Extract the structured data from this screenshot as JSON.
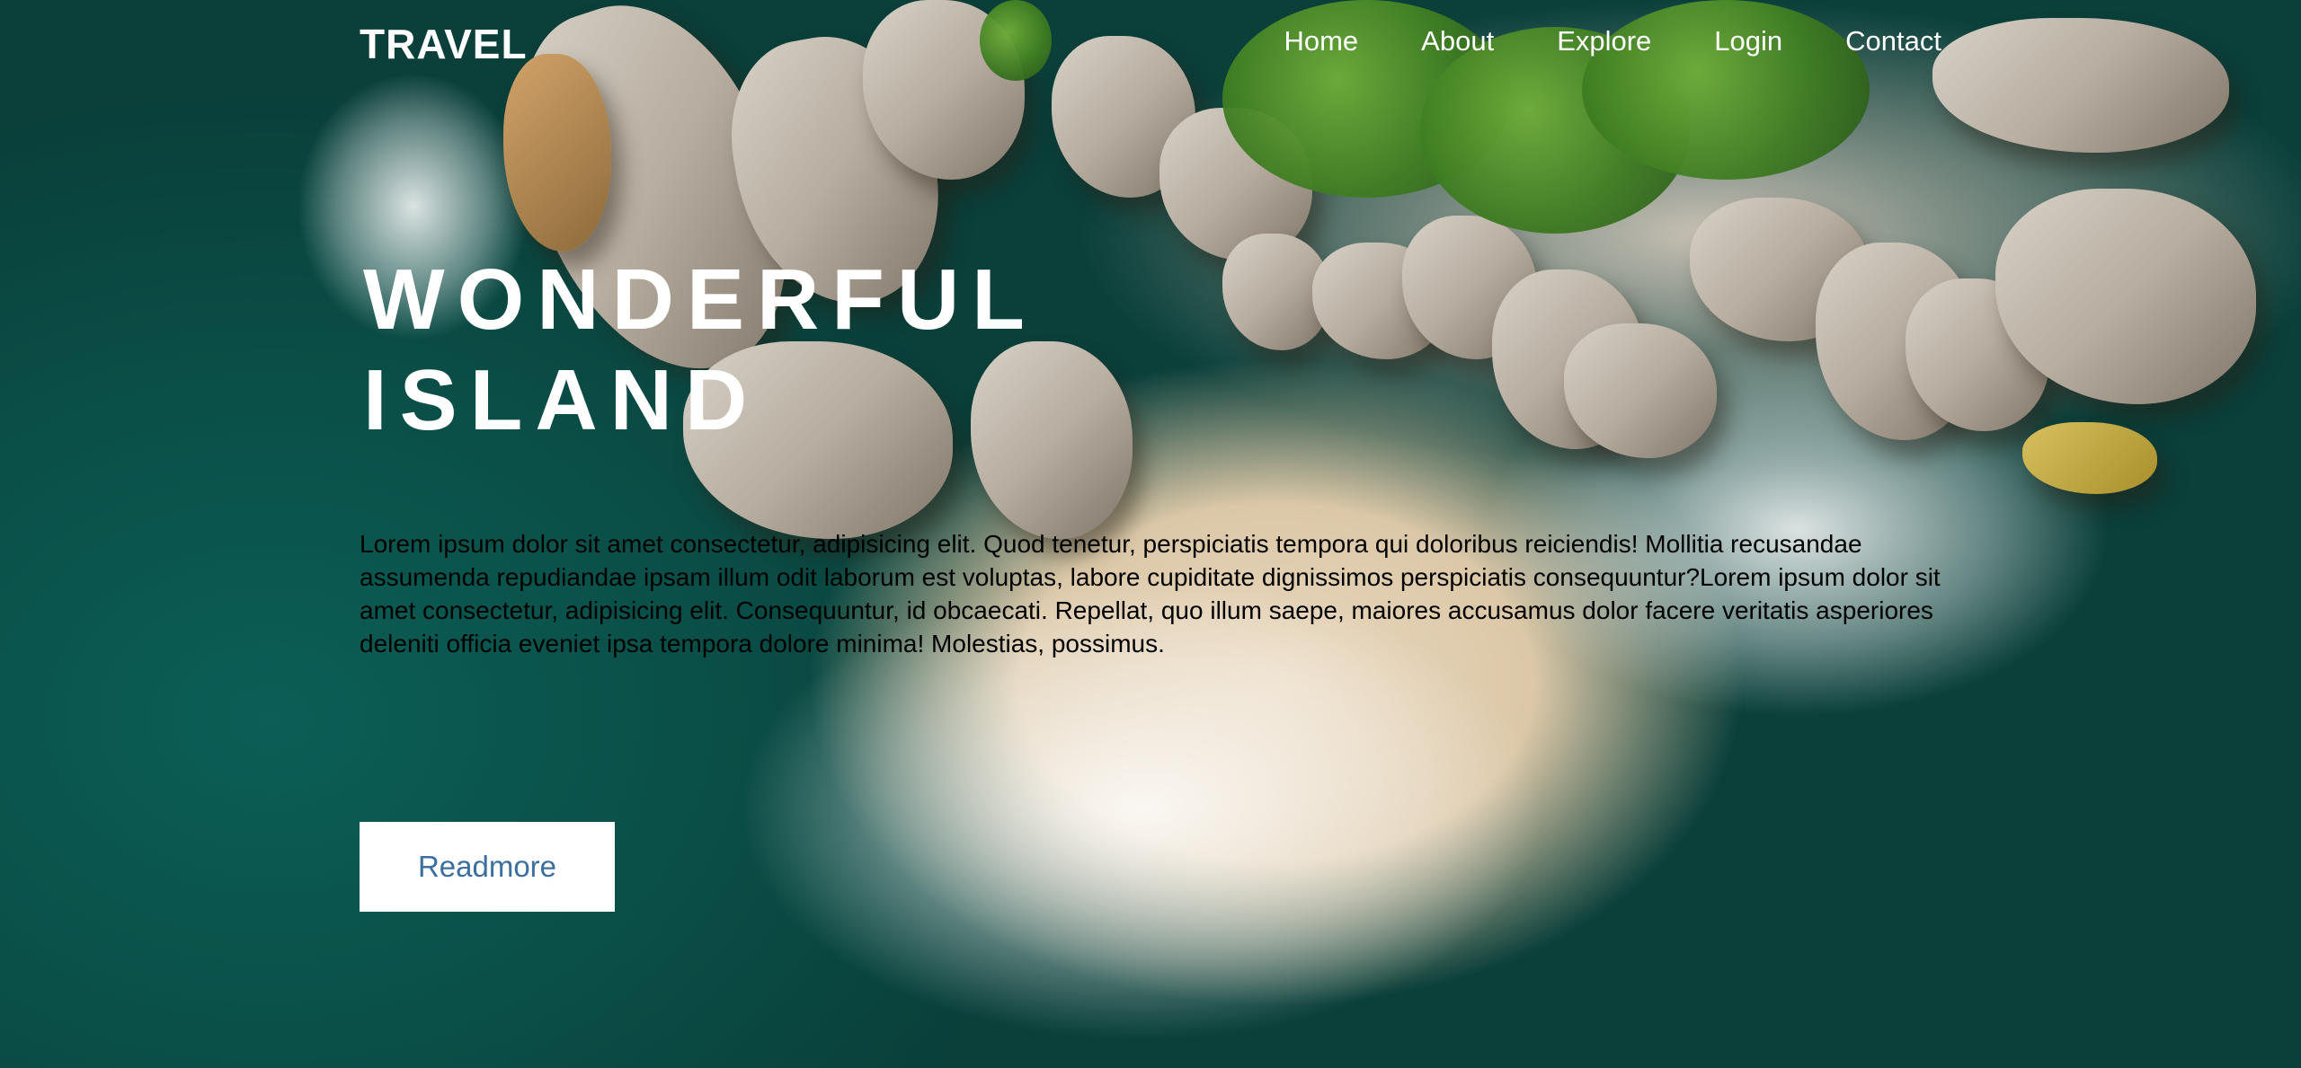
{
  "header": {
    "logo": "TRAVEL",
    "nav": [
      "Home",
      "About",
      "Explore",
      "Login",
      "Contact"
    ]
  },
  "hero": {
    "title_line1": "WONDERFUL",
    "title_line2": "ISLAND",
    "description": "Lorem ipsum dolor sit amet consectetur, adipisicing elit. Quod tenetur, perspiciatis tempora qui doloribus reiciendis! Mollitia recusandae assumenda repudiandae ipsam illum odit laborum est voluptas, labore cupiditate dignissimos perspiciatis consequuntur?Lorem ipsum dolor sit amet consectetur, adipisicing elit. Consequuntur, id obcaecati. Repellat, quo illum saepe, maiores accusamus dolor facere veritatis asperiores deleniti officia eveniet ipsa tempora dolore minima! Molestias, possimus.",
    "button_label": "Readmore"
  },
  "colors": {
    "text_on_image": "#ffffff",
    "button_text": "#3a6f9e",
    "sea": "#14a396"
  }
}
